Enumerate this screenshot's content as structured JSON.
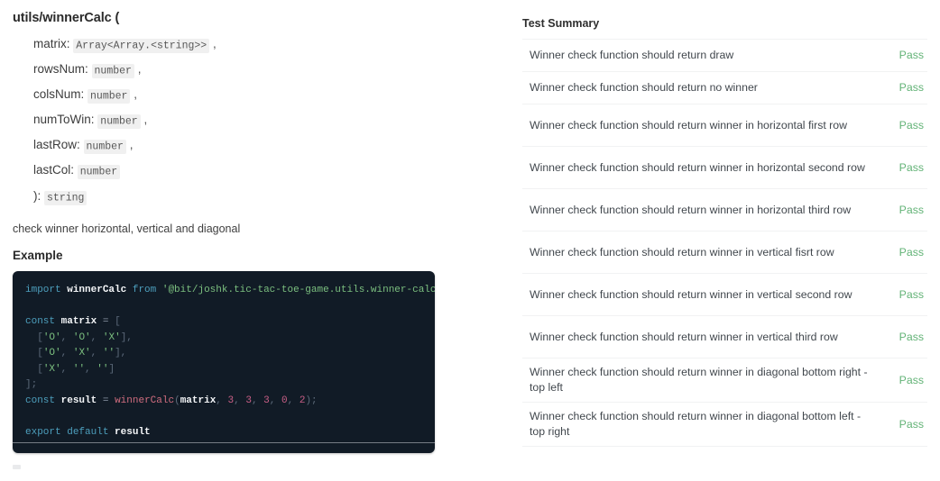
{
  "signature": {
    "name": "utils/winnerCalc",
    "open_paren": "(",
    "close": "):",
    "return_type": "string",
    "params": [
      {
        "name": "matrix:",
        "type": "Array<Array.<string>>",
        "comma": ","
      },
      {
        "name": "rowsNum:",
        "type": "number",
        "comma": ","
      },
      {
        "name": "colsNum:",
        "type": "number",
        "comma": ","
      },
      {
        "name": "numToWin:",
        "type": "number",
        "comma": ","
      },
      {
        "name": "lastRow:",
        "type": "number",
        "comma": ","
      },
      {
        "name": "lastCol:",
        "type": "number",
        "comma": ""
      }
    ]
  },
  "description": "check winner horizontal, vertical and diagonal",
  "example": {
    "heading": "Example",
    "language": "javascript",
    "code": "import winnerCalc from '@bit/joshk.tic-tac-toe-game.utils.winner-calc';\n\nconst matrix = [\n  ['O', 'O', 'X'],\n  ['O', 'X', ''],\n  ['X', '', '']\n];\nconst result = winnerCalc(matrix, 3, 3, 3, 0, 2);\n\nexport default result",
    "theme": {
      "background": "#111b26",
      "keyword": "#4d9fbd",
      "identifier": "#f4f6f8",
      "string": "#7bbf7f",
      "function": "#d16d7f",
      "number": "#c95f86",
      "punctuation": "#5c6a7a"
    }
  },
  "test_summary": {
    "title": "Test Summary",
    "pass_color": "#63b377",
    "rows": [
      {
        "name": "Winner check function should return draw",
        "status": "Pass"
      },
      {
        "name": "Winner check function should return no winner",
        "status": "Pass"
      },
      {
        "name": "Winner check function should return winner in horizontal first row",
        "status": "Pass"
      },
      {
        "name": "Winner check function should return winner in horizontal second row",
        "status": "Pass"
      },
      {
        "name": "Winner check function should return winner in horizontal third row",
        "status": "Pass"
      },
      {
        "name": "Winner check function should return winner in vertical fisrt row",
        "status": "Pass"
      },
      {
        "name": "Winner check function should return winner in vertical second row",
        "status": "Pass"
      },
      {
        "name": "Winner check function should return winner in vertical third row",
        "status": "Pass"
      },
      {
        "name": "Winner check function should return winner in diagonal bottom right - top left",
        "status": "Pass"
      },
      {
        "name": "Winner check function should return winner in diagonal bottom left - top right",
        "status": "Pass"
      }
    ]
  }
}
